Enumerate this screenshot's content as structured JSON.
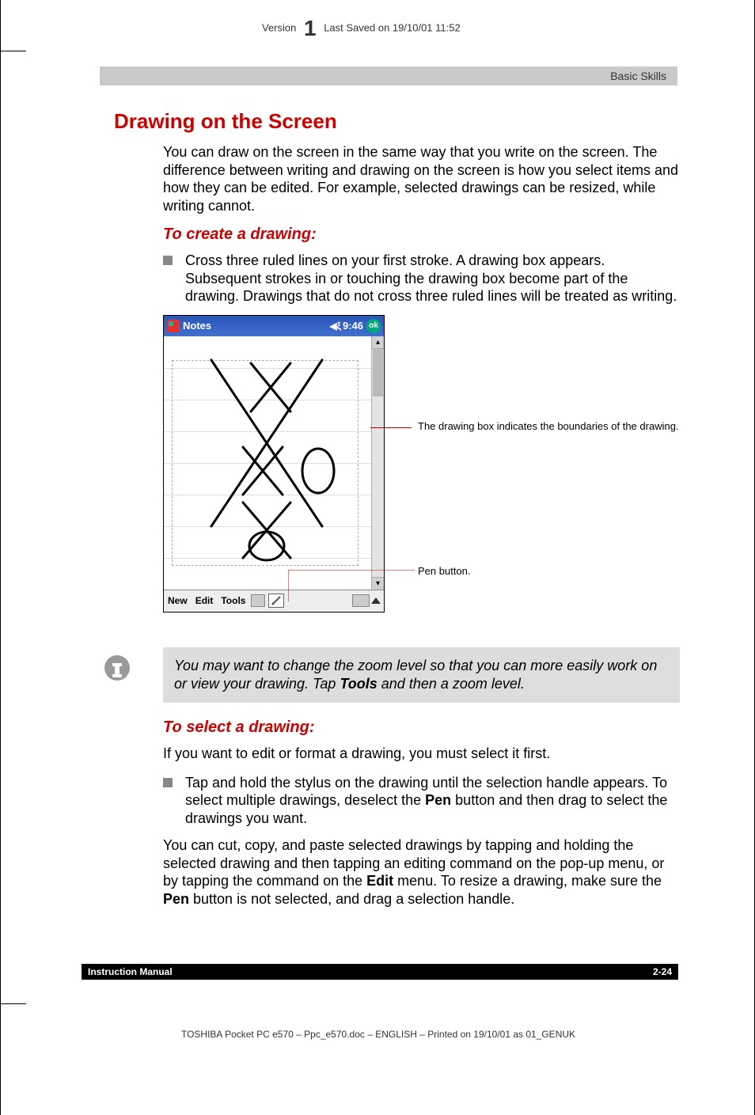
{
  "header": {
    "version_label": "Version",
    "version_num": "1",
    "saved": "Last Saved on 19/10/01 11:52"
  },
  "graybar": "Basic Skills",
  "h1": "Drawing on the Screen",
  "p1": "You can draw on the screen in the same way that you write on the screen. The difference between writing and drawing on the screen is how you select items and how they can be edited. For example, selected drawings can be resized, while writing cannot.",
  "h2a": "To create a drawing:",
  "bullet1": "Cross three ruled lines on your first stroke. A drawing box appears. Subsequent strokes in or touching the drawing box become part of the drawing. Drawings that do not cross three ruled lines will be treated as writing.",
  "pda": {
    "title": "Notes",
    "time": "9:46",
    "ok": "ok",
    "menu_new": "New",
    "menu_edit": "Edit",
    "menu_tools": "Tools"
  },
  "callout1": "The drawing box indicates the boundaries of the drawing.",
  "callout2": "Pen button.",
  "tip_pre": "You may want to change the zoom level so that you can more easily work on or view your drawing. Tap ",
  "tip_bold": "Tools",
  "tip_post": " and then a zoom level.",
  "h2b": "To select a drawing:",
  "p2": "If you want to edit or format a drawing, you must select it first.",
  "bullet2_pre": "Tap and hold the stylus on the drawing until the selection handle appears. To select multiple drawings, deselect the ",
  "bullet2_bold": "Pen",
  "bullet2_post": " button and then drag to select the drawings you want.",
  "p3_pre": "You can cut, copy, and paste selected drawings by tapping and holding the selected drawing and then tapping an editing command on the pop-up menu, or by tapping the command on the ",
  "p3_b1": "Edit",
  "p3_mid": " menu. To resize a drawing, make sure the ",
  "p3_b2": "Pen",
  "p3_post": " button is not selected, and drag a selection handle.",
  "footer": {
    "left": "Instruction Manual",
    "right": "2-24"
  },
  "bottomline": "TOSHIBA Pocket PC e570  – Ppc_e570.doc – ENGLISH – Printed on 19/10/01 as 01_GENUK"
}
